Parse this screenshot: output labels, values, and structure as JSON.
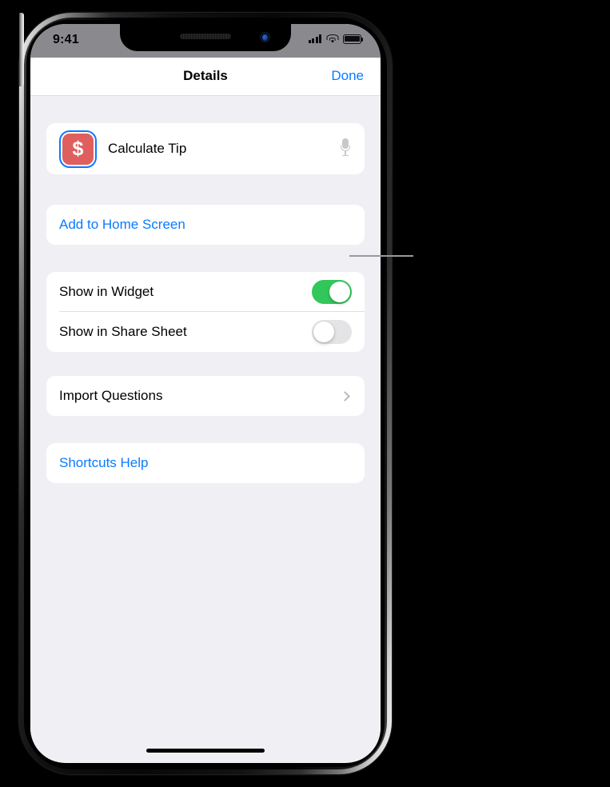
{
  "status_bar": {
    "time": "9:41",
    "signal_icon": "cellular-signal-icon",
    "wifi_icon": "wifi-icon",
    "battery_icon": "battery-icon"
  },
  "nav_bar": {
    "title": "Details",
    "done_label": "Done"
  },
  "colors": {
    "accent_blue": "#0a7aff",
    "toggle_on_green": "#32c75a",
    "toggle_off_gray": "#e4e4e7",
    "app_icon_red": "#df5f5f",
    "content_background": "#f0eff4",
    "card_background": "#ffffff",
    "status_bar_background": "#8a8a8e"
  },
  "shortcut_row": {
    "icon_glyph": "$",
    "icon_name": "dollar-sign-shortcut-icon",
    "name": "Calculate Tip",
    "mic_icon": "microphone-icon"
  },
  "add_home_screen": {
    "label": "Add to Home Screen"
  },
  "toggles": [
    {
      "label": "Show in Widget",
      "state": "on"
    },
    {
      "label": "Show in Share Sheet",
      "state": "off"
    }
  ],
  "import_questions": {
    "label": "Import Questions",
    "disclosure_icon": "chevron-right-icon"
  },
  "help": {
    "label": "Shortcuts Help"
  },
  "home_indicator": "home-indicator"
}
